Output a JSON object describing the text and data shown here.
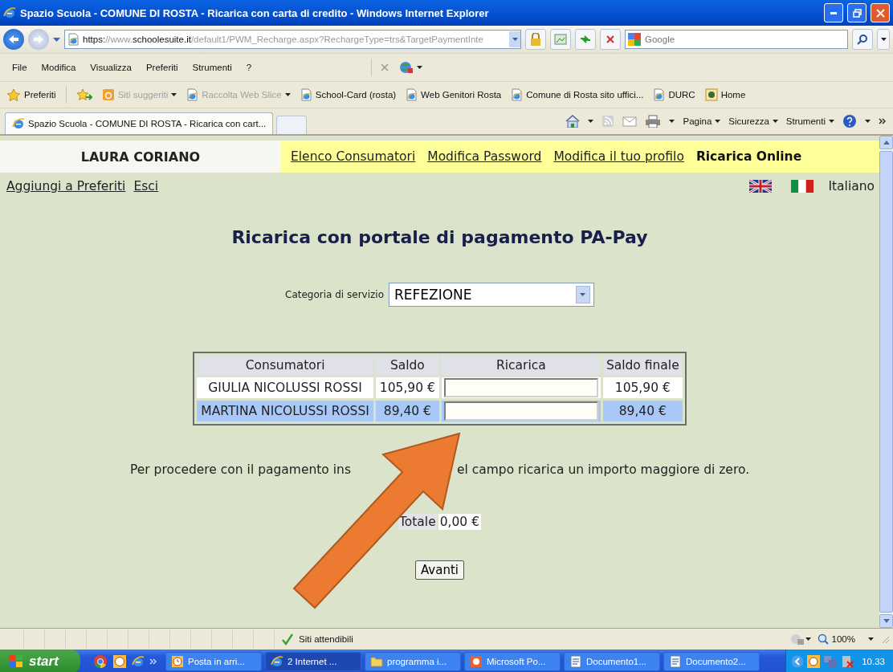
{
  "window": {
    "title": "Spazio Scuola - COMUNE DI ROSTA - Ricarica con carta di credito - Windows Internet Explorer"
  },
  "address_bar": {
    "url": [
      {
        "text": "https:",
        "dim": false
      },
      {
        "text": "//www.",
        "dim": true
      },
      {
        "text": "schoolesuite.it",
        "dim": false
      },
      {
        "text": "/default1/PWM_Recharge.aspx?RechargeType=trs&TargetPaymentInte",
        "dim": true
      }
    ],
    "search_placeholder": "Google"
  },
  "menu_bar": [
    "File",
    "Modifica",
    "Visualizza",
    "Preferiti",
    "Strumenti",
    "?"
  ],
  "favorites_bar": {
    "label": "Preferiti",
    "items": [
      {
        "label": "Siti suggeriti",
        "kind": "suggested",
        "disabled": true,
        "dropdown": true
      },
      {
        "label": "Raccolta Web Slice",
        "kind": "page",
        "disabled": true,
        "dropdown": true
      },
      {
        "label": "School-Card (rosta)",
        "kind": "page",
        "disabled": false,
        "dropdown": false
      },
      {
        "label": "Web Genitori Rosta",
        "kind": "page",
        "disabled": false,
        "dropdown": false
      },
      {
        "label": "Comune di Rosta  sito uffici...",
        "kind": "page",
        "disabled": false,
        "dropdown": false
      },
      {
        "label": "DURC",
        "kind": "page",
        "disabled": false,
        "dropdown": false
      },
      {
        "label": "Home",
        "kind": "emblem",
        "disabled": false,
        "dropdown": false
      }
    ]
  },
  "tabs": [
    {
      "label": "Spazio Scuola - COMUNE DI ROSTA - Ricarica con cart...",
      "selected": true
    }
  ],
  "command_bar": [
    "Pagina",
    "Sicurezza",
    "Strumenti"
  ],
  "page": {
    "user": "LAURA CORIANO",
    "nav": [
      {
        "label": "Elenco Consumatori",
        "selected": false
      },
      {
        "label": "Modifica Password",
        "selected": false
      },
      {
        "label": "Modifica il tuo profilo",
        "selected": false
      },
      {
        "label": "Ricarica Online",
        "selected": true
      }
    ],
    "links": [
      "Aggiungi a Preferiti",
      "Esci"
    ],
    "language": "Italiano",
    "title": "Ricarica con portale di pagamento PA-Pay",
    "category_label": "Categoria di servizio",
    "category_value": "REFEZIONE",
    "table": {
      "columns": [
        "Consumatori",
        "Saldo",
        "Ricarica",
        "Saldo finale"
      ],
      "rows": [
        {
          "name": "GIULIA NICOLUSSI ROSSI",
          "saldo": "105,90 €",
          "saldo_finale": "105,90 €",
          "selected": false
        },
        {
          "name": "MARTINA NICOLUSSI ROSSI",
          "saldo": "89,40 €",
          "saldo_finale": "89,40 €",
          "selected": true
        }
      ]
    },
    "notice_parts": [
      "Per procedere con il pagamento ins",
      "el campo ricarica un importo maggiore di zero."
    ],
    "total_label": "Totale",
    "total_value": "0,00 €",
    "button": "Avanti"
  },
  "status_bar": {
    "zone": "Siti attendibili",
    "zoom": "100%"
  },
  "taskbar": {
    "start": "start",
    "items": [
      {
        "label": "Posta in arri...",
        "kind": "mail",
        "selected": false
      },
      {
        "label": "2 Internet ...",
        "kind": "browser",
        "selected": true
      },
      {
        "label": "programma i...",
        "kind": "folder",
        "selected": false
      },
      {
        "label": "Microsoft Po...",
        "kind": "slides",
        "selected": false
      },
      {
        "label": "Documento1...",
        "kind": "document",
        "selected": false
      },
      {
        "label": "Documento2...",
        "kind": "document",
        "selected": false
      }
    ],
    "clock": "10.33"
  }
}
